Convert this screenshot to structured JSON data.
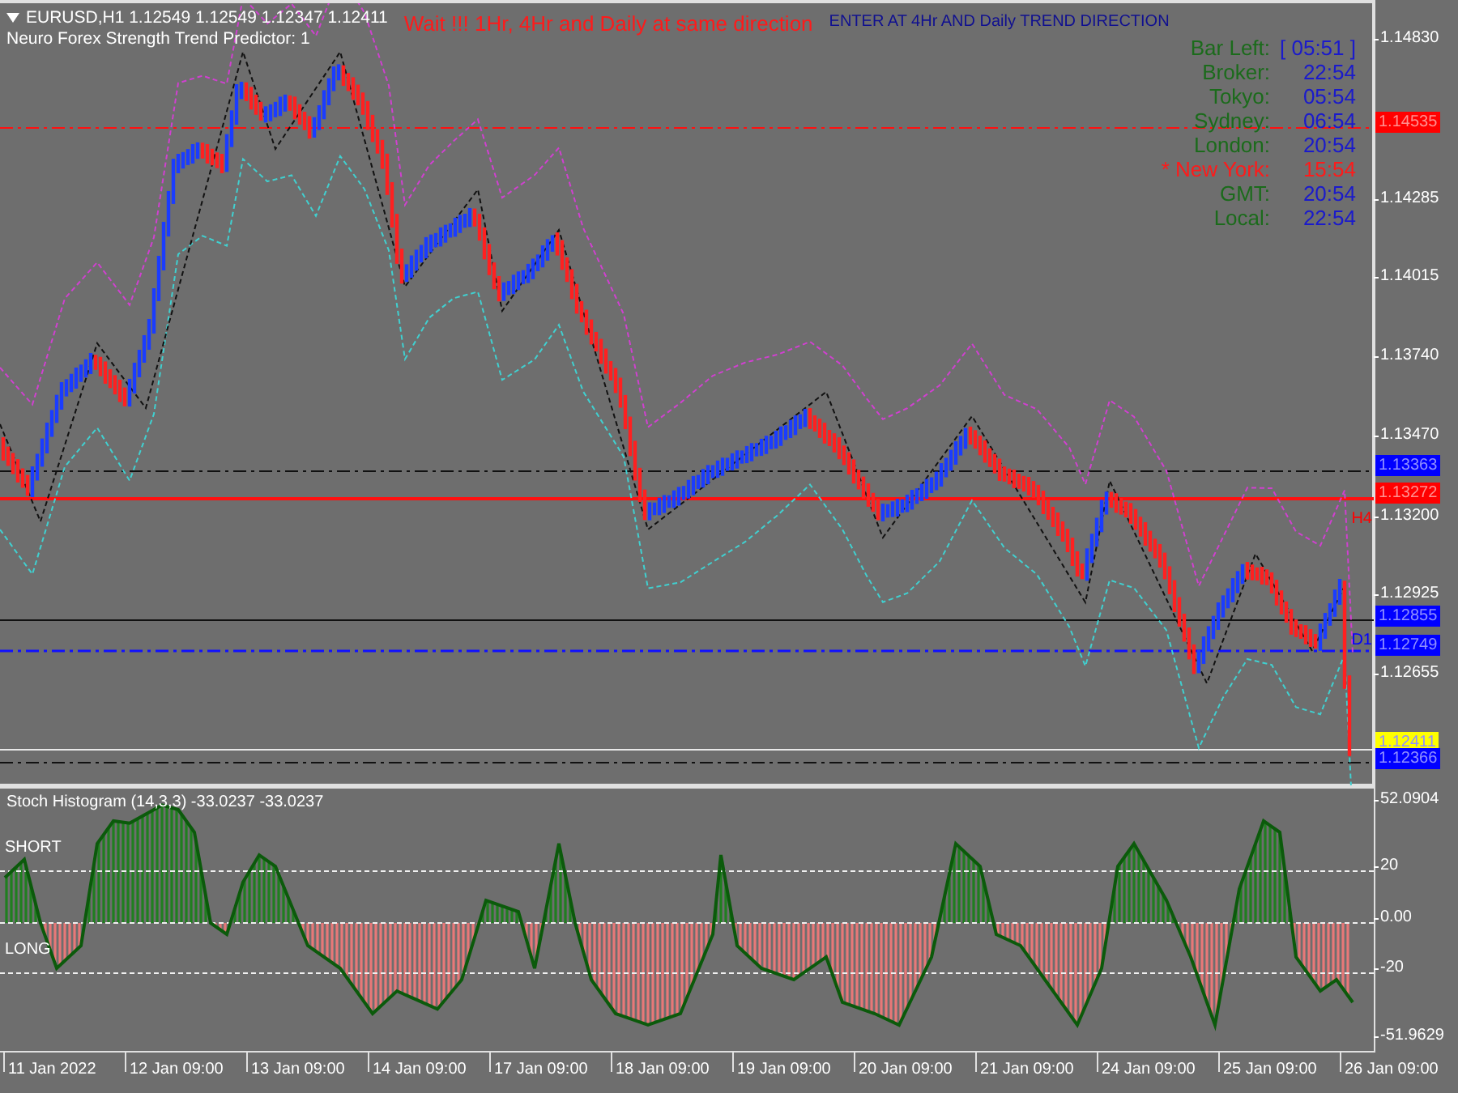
{
  "chart": {
    "symbol_line": "EURUSD,H1  1.12549 1.12549 1.12347 1.12411",
    "indicator_name": "Neuro Forex Strength Trend Predictor: 1",
    "warning": "Wait !!! 1Hr, 4Hr and Daily at same direction",
    "signal": "ENTER AT 4Hr AND Daily TREND DIRECTION",
    "line_labels": [
      {
        "text": "H4",
        "color": "#ff0000"
      },
      {
        "text": "D1",
        "color": "#0000ff"
      }
    ]
  },
  "clock_panel": [
    {
      "label": "Bar Left:",
      "value": "[ 05:51 ]",
      "highlighted": false
    },
    {
      "label": "Broker:",
      "value": "22:54",
      "highlighted": false
    },
    {
      "label": "Tokyo:",
      "value": "05:54",
      "highlighted": false
    },
    {
      "label": "Sydney:",
      "value": "06:54",
      "highlighted": false
    },
    {
      "label": "London:",
      "value": "20:54",
      "highlighted": false
    },
    {
      "label": "* New York:",
      "value": "15:54",
      "highlighted": true
    },
    {
      "label": "GMT:",
      "value": "20:54",
      "highlighted": false
    },
    {
      "label": "Local:",
      "value": "22:54",
      "highlighted": false
    }
  ],
  "price_axis": [
    {
      "label": "1.14830",
      "kind": "tick"
    },
    {
      "label": "1.14535",
      "kind": "tag",
      "color": "#ff0000"
    },
    {
      "label": "1.14285",
      "kind": "tick"
    },
    {
      "label": "1.14015",
      "kind": "tick"
    },
    {
      "label": "1.13740",
      "kind": "tick"
    },
    {
      "label": "1.13470",
      "kind": "tick"
    },
    {
      "label": "1.13363",
      "kind": "tag",
      "color": "#0000ff"
    },
    {
      "label": "1.13272",
      "kind": "tag",
      "color": "#ff0000"
    },
    {
      "label": "1.13200",
      "kind": "tick"
    },
    {
      "label": "1.12925",
      "kind": "tick"
    },
    {
      "label": "1.12855",
      "kind": "tag",
      "color": "#0000ff"
    },
    {
      "label": "1.12749",
      "kind": "tag",
      "color": "#0000ff"
    },
    {
      "label": "1.12655",
      "kind": "tick"
    },
    {
      "label": "1.12411",
      "kind": "tag",
      "color": "#ffff00"
    },
    {
      "label": "1.12366",
      "kind": "tag",
      "color": "#0000ff"
    }
  ],
  "stoch_window": {
    "title": "Stoch Histogram (14,3,3) -33.0237 -33.0237",
    "levels": [
      "SHORT",
      "LONG"
    ],
    "axis": [
      "52.0904",
      "20",
      "0.00",
      "-20",
      "-51.9629"
    ]
  },
  "time_axis": [
    "11 Jan 2022",
    "12 Jan 09:00",
    "13 Jan 09:00",
    "14 Jan 09:00",
    "17 Jan 09:00",
    "18 Jan 09:00",
    "19 Jan 09:00",
    "20 Jan 09:00",
    "21 Jan 09:00",
    "24 Jan 09:00",
    "25 Jan 09:00",
    "26 Jan 09:00"
  ]
}
